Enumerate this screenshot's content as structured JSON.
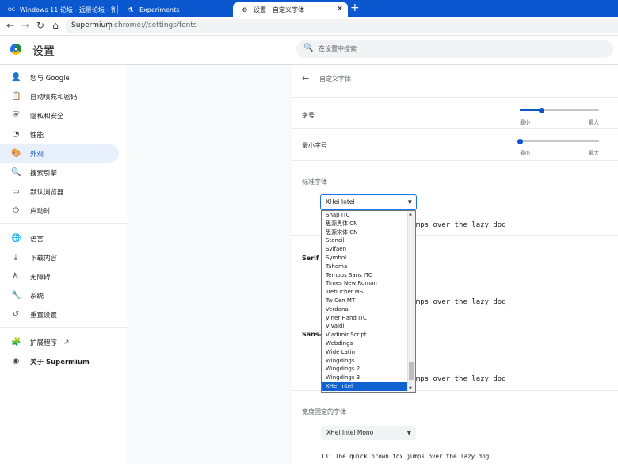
{
  "tabs": [
    {
      "title": "Windows 11 论坛 - 远景论坛 - 微",
      "icon": "OC"
    },
    {
      "title": "Experiments",
      "icon": "flask"
    },
    {
      "title": "设置 - 自定义字体",
      "icon": "gear"
    }
  ],
  "toolbar": {
    "site": "Supermium",
    "url": "chrome://settings/fonts"
  },
  "header": {
    "title": "设置",
    "search_placeholder": "在设置中搜索"
  },
  "sidebar": {
    "items": [
      {
        "label": "您与 Google"
      },
      {
        "label": "自动填充和密码"
      },
      {
        "label": "隐私和安全"
      },
      {
        "label": "性能"
      },
      {
        "label": "外观"
      },
      {
        "label": "搜索引擎"
      },
      {
        "label": "默认浏览器"
      },
      {
        "label": "启动时"
      },
      {
        "label": "语言"
      },
      {
        "label": "下载内容"
      },
      {
        "label": "无障碍"
      },
      {
        "label": "系统"
      },
      {
        "label": "重置设置"
      },
      {
        "label": "扩展程序"
      },
      {
        "label": "关于 Supermium"
      }
    ],
    "selected": "外观"
  },
  "fonts": {
    "page_title": "自定义字体",
    "font_size_label": "字号",
    "min_font_size_label": "最小字号",
    "slider_min": "最小",
    "slider_max": "最大",
    "font_size_value": 0.27,
    "min_font_size_value": 0.0,
    "standard_label": "标准字体",
    "standard_value": "XHei Intel",
    "serif_label": "Serif 字",
    "sans_label": "Sans-s",
    "fixed_label": "宽度固定的字体",
    "fixed_value": "XHei Intel Mono",
    "sample_standard": "jumps over the lazy dog",
    "sample_serif": "jumps over the lazy dog",
    "sample_sans": "jumps over the lazy dog",
    "sample_fixed": "13: The quick brown fox jumps over the lazy dog"
  },
  "dropdown_options": [
    "Snap ITC",
    "思源黑体 CN",
    "思源宋体 CN",
    "Stencil",
    "Sylfaen",
    "Symbol",
    "Tahoma",
    "Tempus Sans ITC",
    "Times New Roman",
    "Trebuchet MS",
    "Tw Cen MT",
    "Verdana",
    "Viner Hand ITC",
    "Vivaldi",
    "Vladimir Script",
    "Webdings",
    "Wide Latin",
    "Wingdings",
    "Wingdings 2",
    "Wingdings 3",
    "XHei Intel"
  ],
  "dropdown_highlighted": "XHei Intel"
}
